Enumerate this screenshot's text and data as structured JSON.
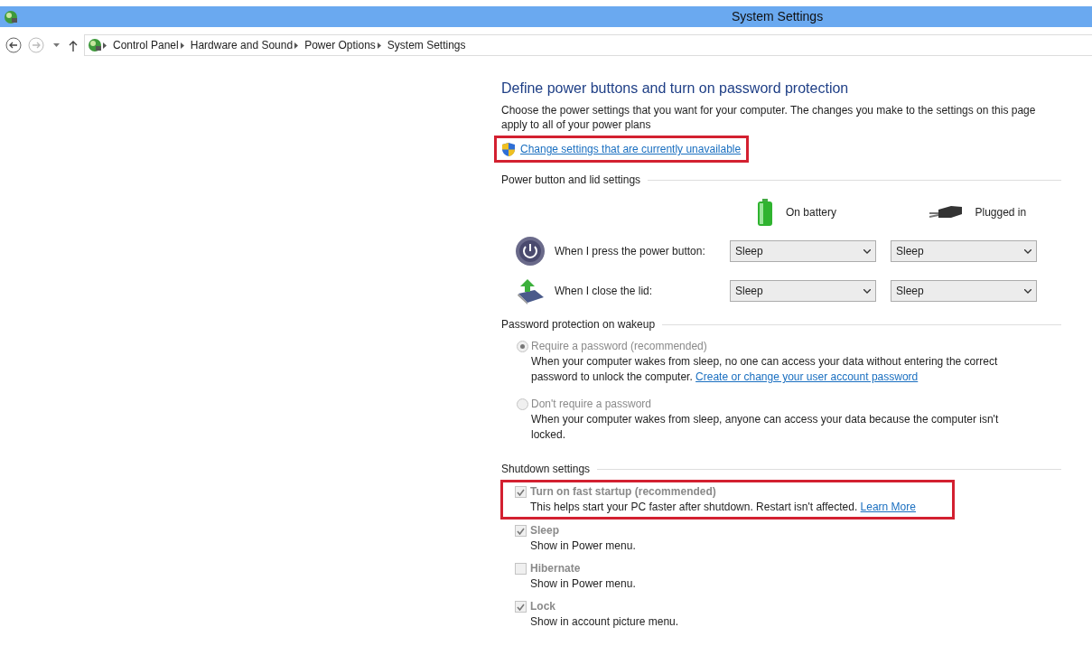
{
  "window": {
    "title": "System Settings"
  },
  "breadcrumb": [
    "Control Panel",
    "Hardware and Sound",
    "Power Options",
    "System Settings"
  ],
  "heading": "Define power buttons and turn on password protection",
  "intro": "Choose the power settings that you want for your computer. The changes you make to the settings on this page apply to all of your power plans",
  "admin_link": {
    "label": "Change settings that are currently unavailable",
    "highlighted": true
  },
  "power_section": {
    "title": "Power button and lid settings",
    "columns": [
      {
        "kind": "battery",
        "label": "On battery"
      },
      {
        "kind": "plug",
        "label": "Plugged in"
      }
    ],
    "rows": [
      {
        "kind": "power",
        "label": "When I press the power button:",
        "values": [
          "Sleep",
          "Sleep"
        ]
      },
      {
        "kind": "lid",
        "label": "When I close the lid:",
        "values": [
          "Sleep",
          "Sleep"
        ]
      }
    ]
  },
  "password_section": {
    "title": "Password protection on wakeup",
    "options": [
      {
        "label": "Require a password (recommended)",
        "selected": true,
        "disabled": true,
        "description": "When your computer wakes from sleep, no one can access your data without entering the correct password to unlock the computer.",
        "link": "Create or change your user account password"
      },
      {
        "label": "Don't require a password",
        "selected": false,
        "disabled": true,
        "description": "When your computer wakes from sleep, anyone can access your data because the computer isn't locked."
      }
    ]
  },
  "shutdown_section": {
    "title": "Shutdown settings",
    "items": [
      {
        "label": "Turn on fast startup (recommended)",
        "checked": true,
        "highlighted": true,
        "description": "This helps start your PC faster after shutdown. Restart isn't affected.",
        "link": "Learn More"
      },
      {
        "label": "Sleep",
        "checked": true,
        "highlighted": false,
        "description": "Show in Power menu."
      },
      {
        "label": "Hibernate",
        "checked": false,
        "highlighted": false,
        "description": "Show in Power menu."
      },
      {
        "label": "Lock",
        "checked": true,
        "highlighted": false,
        "description": "Show in account picture menu."
      }
    ]
  }
}
